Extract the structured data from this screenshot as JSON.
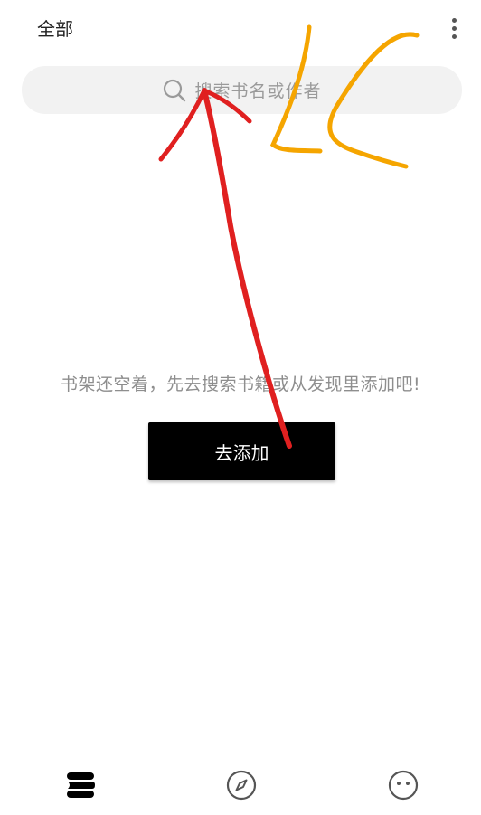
{
  "header": {
    "title": "全部",
    "more_icon": "more-vertical-icon"
  },
  "search": {
    "placeholder": "搜索书名或作者",
    "icon": "search-icon"
  },
  "empty_state": {
    "message": "书架还空着，先去搜索书籍或从发现里添加吧!",
    "button_label": "去添加"
  },
  "bottom_nav": {
    "items": [
      {
        "icon": "bookshelf-icon",
        "active": true
      },
      {
        "icon": "compass-icon",
        "active": false
      },
      {
        "icon": "smiley-face-icon",
        "active": false
      }
    ]
  },
  "colors": {
    "background": "#ffffff",
    "search_bg": "#f2f2f2",
    "button_bg": "#000000",
    "annotation_red": "#e02020",
    "annotation_orange": "#f5a500"
  }
}
